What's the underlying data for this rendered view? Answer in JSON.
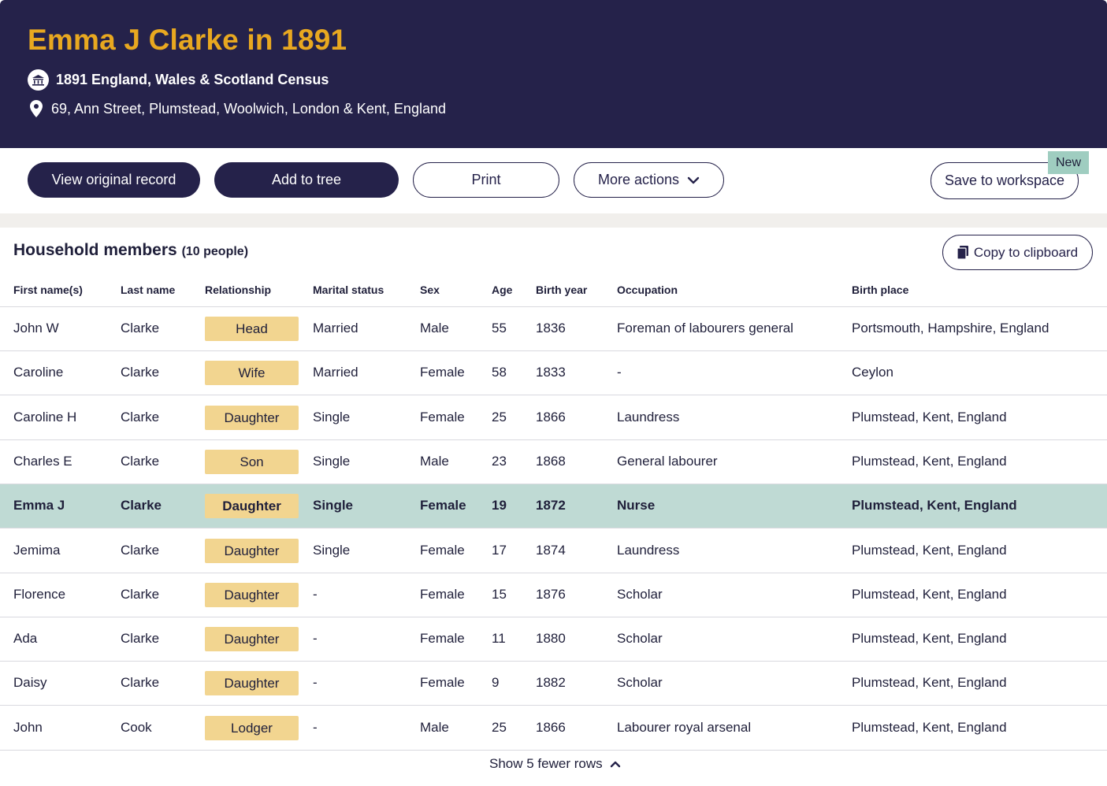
{
  "header": {
    "title": "Emma J Clarke in 1891",
    "census": "1891 England, Wales & Scotland Census",
    "address": "69, Ann Street, Plumstead, Woolwich, London & Kent, England"
  },
  "toolbar": {
    "view_original": "View original record",
    "add_to_tree": "Add to tree",
    "print": "Print",
    "more_actions": "More actions",
    "save_workspace": "Save to workspace",
    "new_badge": "New"
  },
  "household": {
    "title": "Household members",
    "count": "(10 people)",
    "copy": "Copy to clipboard",
    "columns": [
      "First name(s)",
      "Last name",
      "Relationship",
      "Marital status",
      "Sex",
      "Age",
      "Birth year",
      "Occupation",
      "Birth place"
    ],
    "rows": [
      {
        "first": "John W",
        "last": "Clarke",
        "relationship": "Head",
        "marital": "Married",
        "sex": "Male",
        "age": "55",
        "birth_year": "1836",
        "occupation": "Foreman of labourers general",
        "birth_place": "Portsmouth, Hampshire, England",
        "highlight": false
      },
      {
        "first": "Caroline",
        "last": "Clarke",
        "relationship": "Wife",
        "marital": "Married",
        "sex": "Female",
        "age": "58",
        "birth_year": "1833",
        "occupation": "-",
        "birth_place": "Ceylon",
        "highlight": false
      },
      {
        "first": "Caroline H",
        "last": "Clarke",
        "relationship": "Daughter",
        "marital": "Single",
        "sex": "Female",
        "age": "25",
        "birth_year": "1866",
        "occupation": "Laundress",
        "birth_place": "Plumstead, Kent, England",
        "highlight": false
      },
      {
        "first": "Charles E",
        "last": "Clarke",
        "relationship": "Son",
        "marital": "Single",
        "sex": "Male",
        "age": "23",
        "birth_year": "1868",
        "occupation": "General labourer",
        "birth_place": "Plumstead, Kent, England",
        "highlight": false
      },
      {
        "first": "Emma J",
        "last": "Clarke",
        "relationship": "Daughter",
        "marital": "Single",
        "sex": "Female",
        "age": "19",
        "birth_year": "1872",
        "occupation": "Nurse",
        "birth_place": "Plumstead, Kent, England",
        "highlight": true
      },
      {
        "first": "Jemima",
        "last": "Clarke",
        "relationship": "Daughter",
        "marital": "Single",
        "sex": "Female",
        "age": "17",
        "birth_year": "1874",
        "occupation": "Laundress",
        "birth_place": "Plumstead, Kent, England",
        "highlight": false
      },
      {
        "first": "Florence",
        "last": "Clarke",
        "relationship": "Daughter",
        "marital": "-",
        "sex": "Female",
        "age": "15",
        "birth_year": "1876",
        "occupation": "Scholar",
        "birth_place": "Plumstead, Kent, England",
        "highlight": false
      },
      {
        "first": "Ada",
        "last": "Clarke",
        "relationship": "Daughter",
        "marital": "-",
        "sex": "Female",
        "age": "11",
        "birth_year": "1880",
        "occupation": "Scholar",
        "birth_place": "Plumstead, Kent, England",
        "highlight": false
      },
      {
        "first": "Daisy",
        "last": "Clarke",
        "relationship": "Daughter",
        "marital": "-",
        "sex": "Female",
        "age": "9",
        "birth_year": "1882",
        "occupation": "Scholar",
        "birth_place": "Plumstead, Kent, England",
        "highlight": false
      },
      {
        "first": "John",
        "last": "Cook",
        "relationship": "Lodger",
        "marital": "-",
        "sex": "Male",
        "age": "25",
        "birth_year": "1866",
        "occupation": "Labourer royal arsenal",
        "birth_place": "Plumstead, Kent, England",
        "highlight": false
      }
    ],
    "show_fewer": "Show 5 fewer rows"
  },
  "colors": {
    "header_bg": "#25224a",
    "title_accent": "#e8a820",
    "chip_bg": "#f2d590",
    "highlight_row": "#bfdad4",
    "new_badge": "#9fcdc0"
  },
  "icons": [
    "census-building-icon",
    "location-pin-icon",
    "chevron-down-icon",
    "clipboard-icon",
    "chevron-up-icon"
  ]
}
